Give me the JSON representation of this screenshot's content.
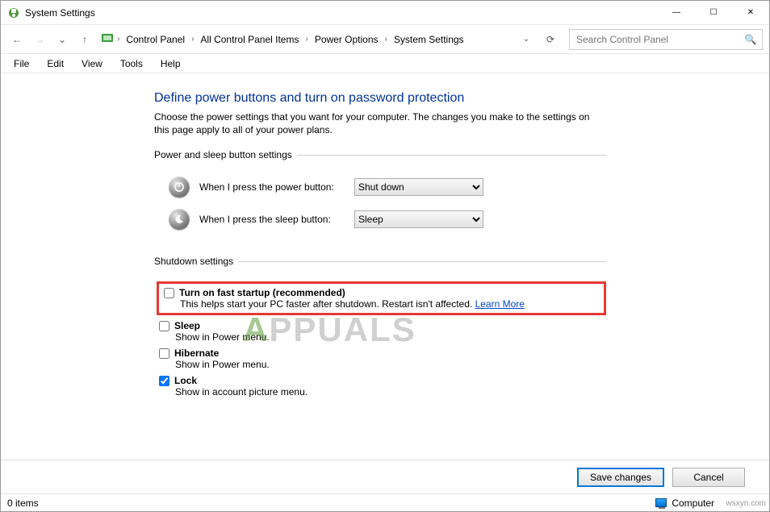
{
  "titlebar": {
    "title": "System Settings"
  },
  "window_controls": {
    "min": "—",
    "max": "☐",
    "close": "✕"
  },
  "nav": {
    "back": "←",
    "forward": "→",
    "recent": "⌄",
    "up": "↑",
    "crumb_dropdown": "⌄",
    "refresh": "⟳"
  },
  "breadcrumbs": [
    "Control Panel",
    "All Control Panel Items",
    "Power Options",
    "System Settings"
  ],
  "search": {
    "placeholder": "Search Control Panel",
    "icon": "🔍"
  },
  "menu": {
    "file": "File",
    "edit": "Edit",
    "view": "View",
    "tools": "Tools",
    "help": "Help"
  },
  "heading": "Define power buttons and turn on password protection",
  "description": "Choose the power settings that you want for your computer. The changes you make to the settings on this page apply to all of your power plans.",
  "group1": {
    "legend": "Power and sleep button settings",
    "power_label": "When I press the power button:",
    "power_value": "Shut down",
    "sleep_label": "When I press the sleep button:",
    "sleep_value": "Sleep"
  },
  "group2": {
    "legend": "Shutdown settings",
    "fast": {
      "title": "Turn on fast startup (recommended)",
      "desc": "This helps start your PC faster after shutdown. Restart isn't affected. ",
      "link": "Learn More",
      "checked": false
    },
    "sleep": {
      "title": "Sleep",
      "desc": "Show in Power menu.",
      "checked": false
    },
    "hibernate": {
      "title": "Hibernate",
      "desc": "Show in Power menu.",
      "checked": false
    },
    "lock": {
      "title": "Lock",
      "desc": "Show in account picture menu.",
      "checked": true
    }
  },
  "buttons": {
    "save": "Save changes",
    "cancel": "Cancel"
  },
  "statusbar": {
    "left": "0 items",
    "right": "Computer"
  },
  "watermark": "PPUALS",
  "attribution": "wsxyn.com"
}
